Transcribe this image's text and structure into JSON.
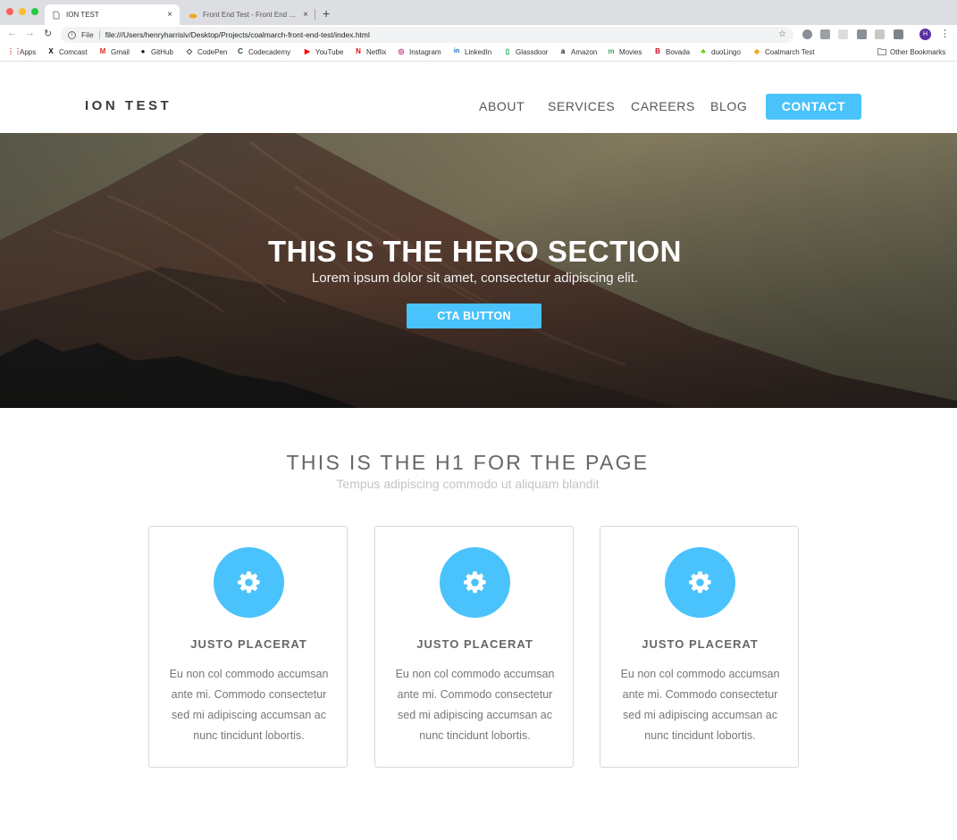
{
  "browser": {
    "tabs": [
      {
        "title": "ION TEST",
        "active": true,
        "close": "×"
      },
      {
        "title": "Front End Test - Front End Test",
        "active": false,
        "close": "×"
      }
    ],
    "new_tab": "+",
    "nav": {
      "back": "←",
      "forward": "→",
      "reload": "↻"
    },
    "address": {
      "scheme_label": "File",
      "url": "file:///Users/henryharrisiv/Desktop/Projects/coalmarch-front-end-test/index.html",
      "star": "☆"
    },
    "profile_initial": "H",
    "menu": "⋮",
    "bookmarks": [
      {
        "label": "Apps",
        "icon": "apps-grid-icon",
        "glyph": "⋮⋮",
        "color": "#d93025"
      },
      {
        "label": "Comcast",
        "icon": "x-logo-icon",
        "glyph": "X",
        "color": "#000000"
      },
      {
        "label": "Gmail",
        "icon": "gmail-icon",
        "glyph": "M",
        "color": "#d93025"
      },
      {
        "label": "GitHub",
        "icon": "github-icon",
        "glyph": "●",
        "color": "#111111"
      },
      {
        "label": "CodePen",
        "icon": "codepen-icon",
        "glyph": "◇",
        "color": "#222222"
      },
      {
        "label": "Codecademy",
        "icon": "codecademy-icon",
        "glyph": "C",
        "color": "#1f4056"
      },
      {
        "label": "YouTube",
        "icon": "youtube-icon",
        "glyph": "▶",
        "color": "#ff0000"
      },
      {
        "label": "Netflix",
        "icon": "netflix-icon",
        "glyph": "N",
        "color": "#e50914"
      },
      {
        "label": "Instagram",
        "icon": "instagram-icon",
        "glyph": "◎",
        "color": "#c13584"
      },
      {
        "label": "LinkedIn",
        "icon": "linkedin-icon",
        "glyph": "in",
        "color": "#0a66c2"
      },
      {
        "label": "Glassdoor",
        "icon": "glassdoor-icon",
        "glyph": "▯",
        "color": "#0caa41"
      },
      {
        "label": "Amazon",
        "icon": "amazon-icon",
        "glyph": "a",
        "color": "#111111"
      },
      {
        "label": "Movies",
        "icon": "movies-icon",
        "glyph": "m",
        "color": "#3aa757"
      },
      {
        "label": "Bovada",
        "icon": "bovada-icon",
        "glyph": "B",
        "color": "#d0021b"
      },
      {
        "label": "duoLingo",
        "icon": "duolingo-icon",
        "glyph": "♣",
        "color": "#58cc02"
      },
      {
        "label": "Coalmarch Test",
        "icon": "coalmarch-icon",
        "glyph": "◆",
        "color": "#f5a623"
      }
    ],
    "other_bookmarks": "Other Bookmarks"
  },
  "site": {
    "logo": "ION TEST",
    "nav": [
      "ABOUT",
      "SERVICES",
      "CAREERS",
      "BLOG"
    ],
    "contact": "CONTACT",
    "accent": "#4ac2fb"
  },
  "hero": {
    "title": "THIS IS THE HERO SECTION",
    "subtitle": "Lorem ipsum dolor sit amet, consectetur adipiscing elit.",
    "cta": "CTA BUTTON"
  },
  "main": {
    "h1": "THIS IS THE H1 FOR THE PAGE",
    "subtitle": "Tempus adipiscing commodo ut aliquam blandit",
    "cards": [
      {
        "icon": "gear-icon",
        "title": "JUSTO PLACERAT",
        "text": "Eu non col commodo accumsan ante mi. Commodo consectetur sed mi adipiscing accumsan ac nunc tincidunt lobortis."
      },
      {
        "icon": "gear-icon",
        "title": "JUSTO PLACERAT",
        "text": "Eu non col commodo accumsan ante mi. Commodo consectetur sed mi adipiscing accumsan ac nunc tincidunt lobortis."
      },
      {
        "icon": "gear-icon",
        "title": "JUSTO PLACERAT",
        "text": "Eu non col commodo accumsan ante mi. Commodo consectetur sed mi adipiscing accumsan ac nunc tincidunt lobortis."
      }
    ]
  }
}
